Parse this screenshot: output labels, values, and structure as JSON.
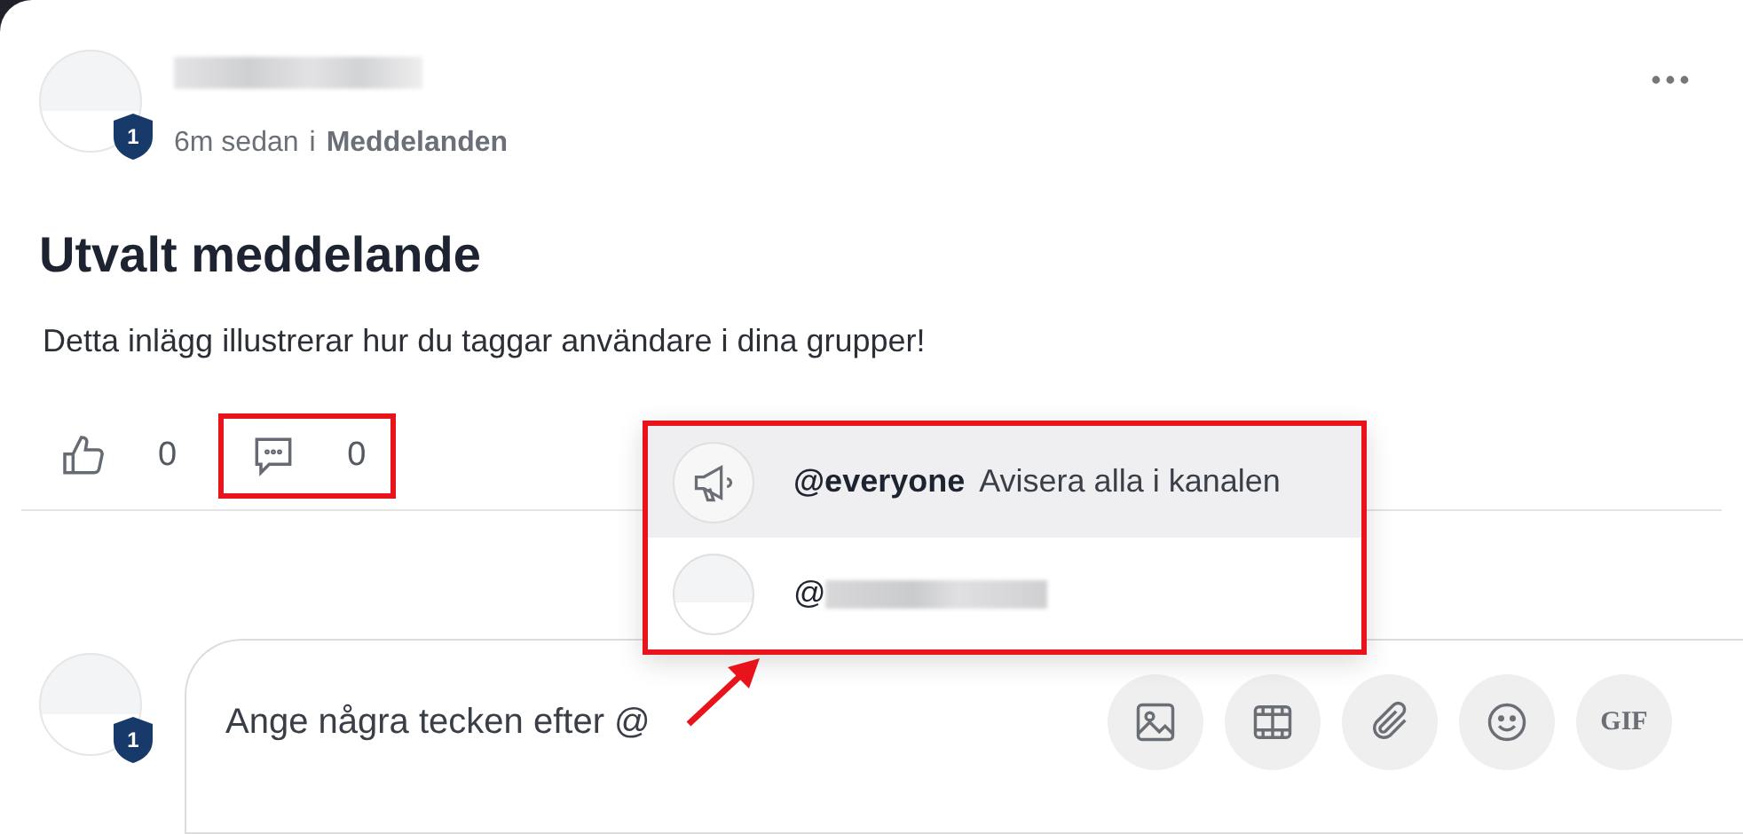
{
  "post": {
    "author_badge": "1",
    "time": "6m sedan",
    "in_word": "i",
    "channel": "Meddelanden",
    "title": "Utvalt meddelande",
    "body": "Detta inlägg illustrerar hur du taggar användare i dina grupper!"
  },
  "actions": [
    {
      "kind": "like",
      "count": "0",
      "highlighted": false
    },
    {
      "kind": "comment",
      "count": "0",
      "highlighted": true
    }
  ],
  "mention_popup": {
    "highlighted": true,
    "items": [
      {
        "kind": "everyone",
        "handle": "@everyone",
        "description": "Avisera alla i kanalen",
        "selected": true
      },
      {
        "kind": "user",
        "handle": "@",
        "selected": false
      }
    ]
  },
  "composer": {
    "user_badge": "1",
    "placeholder": "Ange några tecken efter @",
    "buttons": [
      {
        "kind": "image"
      },
      {
        "kind": "video"
      },
      {
        "kind": "attachment"
      },
      {
        "kind": "emoji"
      },
      {
        "kind": "gif",
        "label": "GIF"
      }
    ]
  }
}
